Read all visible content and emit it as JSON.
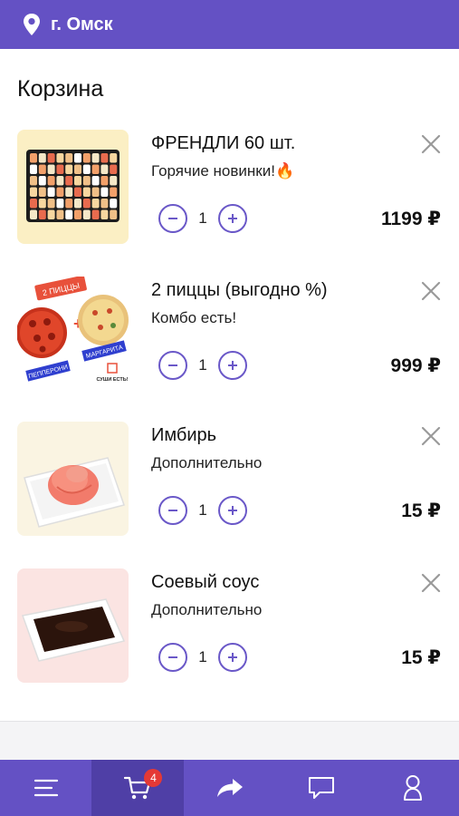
{
  "header": {
    "location_icon": "map-pin-icon",
    "city": "г. Омск"
  },
  "page": {
    "title": "Корзина"
  },
  "cart": {
    "currency": "₽",
    "items": [
      {
        "name": "ФРЕНДЛИ 60 шт.",
        "description": "Горячие новинки!🔥",
        "quantity": "1",
        "price": "1199 ₽",
        "image": "sushi-set-image"
      },
      {
        "name": "2 пиццы (выгодно %)",
        "description": "Комбо есть!",
        "quantity": "1",
        "price": "999 ₽",
        "image": "two-pizzas-image",
        "image_labels": {
          "banner": "2 ПИЦЦЫ",
          "left": "ПЕППЕРОНИ",
          "right": "МАРГАРИТА",
          "logo": "СУШИ ЕСТЬ!"
        }
      },
      {
        "name": "Имбирь",
        "description": "Дополнительно",
        "quantity": "1",
        "price": "15 ₽",
        "image": "ginger-image"
      },
      {
        "name": "Соевый соус",
        "description": "Дополнительно",
        "quantity": "1",
        "price": "15 ₽",
        "image": "soy-sauce-image"
      }
    ]
  },
  "nav": {
    "tabs": [
      {
        "icon": "menu-icon"
      },
      {
        "icon": "cart-icon",
        "badge": "4",
        "active": true
      },
      {
        "icon": "share-icon"
      },
      {
        "icon": "chat-icon"
      },
      {
        "icon": "profile-icon"
      }
    ]
  },
  "colors": {
    "brand": "#6451c4",
    "brand_active": "#4f3fa6",
    "badge": "#e53935",
    "stepper": "#6a58c8"
  }
}
